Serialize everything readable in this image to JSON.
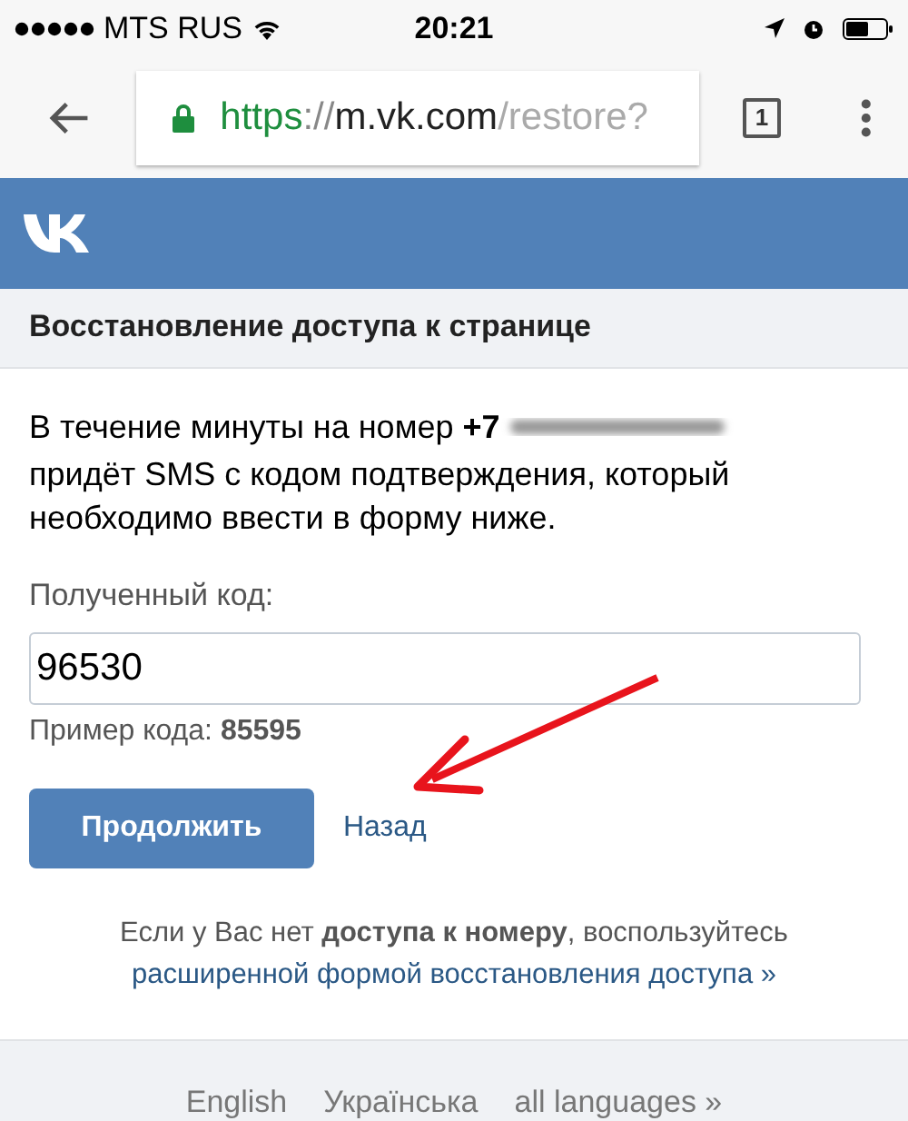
{
  "status_bar": {
    "carrier": "MTS RUS",
    "time": "20:21"
  },
  "browser": {
    "url": {
      "scheme": "https",
      "separator": "://",
      "host": "m.vk.com",
      "path": "/restore?"
    },
    "tab_count": "1"
  },
  "section_title": "Восстановление доступа к странице",
  "intro": {
    "first_line": "В течение минуты на номер **+7**",
    "rest": "придёт SMS с кодом подтверждения, который необходимо ввести в форму ниже."
  },
  "code_field": {
    "label": "Полученный код:",
    "value": "96530"
  },
  "example": "Пример кода: **85595**",
  "buttons": {
    "primary": "Продолжить",
    "back": "Назад"
  },
  "note": {
    "text": "Если у Вас нет **доступа к номеру**, воспользуйтесь",
    "link": "расширенной формой восстановления доступа »"
  },
  "footer_languages": [
    "English",
    "Українська",
    "all languages »"
  ]
}
